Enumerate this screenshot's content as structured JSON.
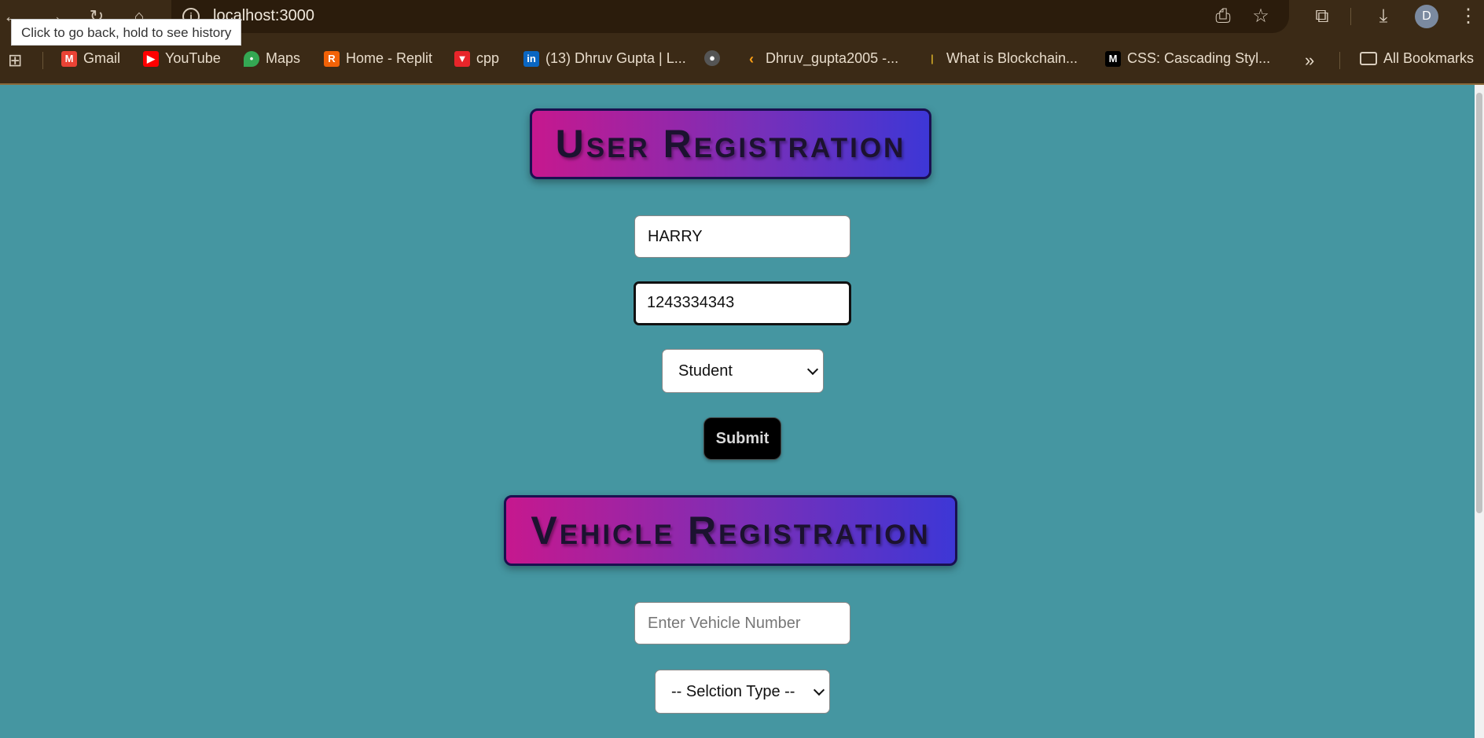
{
  "browser": {
    "url": "localhost:3000",
    "tooltip": "Click to go back, hold to see history",
    "avatar_letter": "D",
    "bookmarks": [
      {
        "label": "Gmail",
        "icon": "gmail-icon",
        "color": "#ea4335"
      },
      {
        "label": "YouTube",
        "icon": "youtube-icon",
        "color": "#ff0000"
      },
      {
        "label": "Maps",
        "icon": "maps-icon",
        "color": "#34a853"
      },
      {
        "label": "Home - Replit",
        "icon": "replit-icon",
        "color": "#f26207"
      },
      {
        "label": "cpp",
        "icon": "cpp-icon",
        "color": "#e8252a"
      },
      {
        "label": "(13) Dhruv Gupta | L...",
        "icon": "linkedin-icon",
        "color": "#0a66c2"
      },
      {
        "label": "",
        "icon": "github-icon",
        "color": "#222222"
      },
      {
        "label": "Dhruv_gupta2005 -...",
        "icon": "leetcode-icon",
        "color": "#ffa116"
      },
      {
        "label": "What is Blockchain...",
        "icon": "blockchain-icon",
        "color": "#c9a227"
      },
      {
        "label": "CSS: Cascading Styl...",
        "icon": "mdn-icon",
        "color": "#000000"
      }
    ],
    "all_bookmarks": "All Bookmarks"
  },
  "user_registration": {
    "title": "User Registration",
    "name_value": "HARRY",
    "phone_value": "1243334343",
    "role_selected": "Student",
    "submit_label": "Submit"
  },
  "vehicle_registration": {
    "title": "Vehicle Registration",
    "vehicle_placeholder": "Enter Vehicle Number",
    "type_selected": "-- Selction Type --"
  },
  "colors": {
    "page_background": "#4596a1",
    "heading_gradient_start": "#c6188e",
    "heading_gradient_end": "#3d37d6",
    "browser_chrome": "#3b2a16"
  }
}
